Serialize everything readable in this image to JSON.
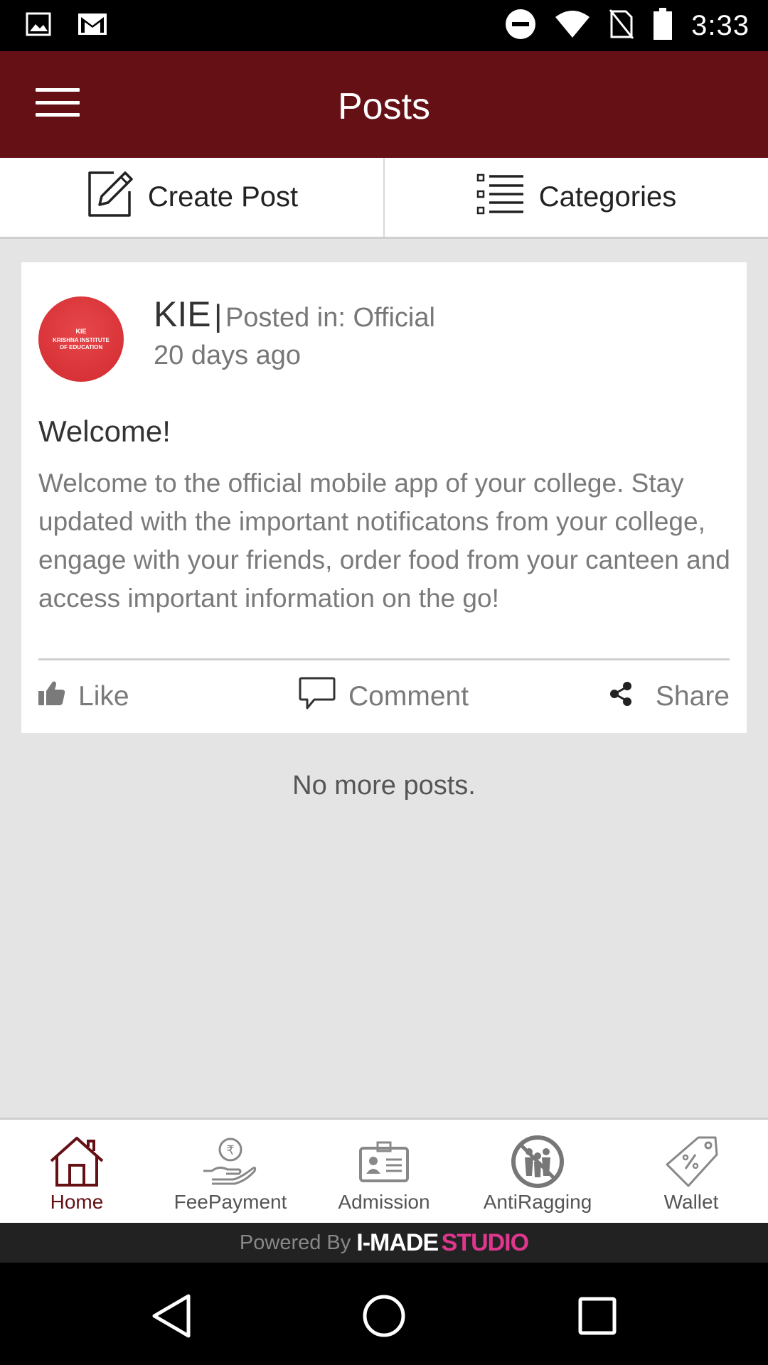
{
  "status_bar": {
    "time": "3:33",
    "icons": [
      "image-icon",
      "gmail-icon",
      "do-not-disturb-icon",
      "wifi-icon",
      "no-sim-icon",
      "battery-icon"
    ]
  },
  "app_bar": {
    "title": "Posts",
    "color": "#651015"
  },
  "actions": {
    "create_post": "Create Post",
    "categories": "Categories"
  },
  "post": {
    "avatar_text_line1": "KIE",
    "avatar_text_line2": "KRISHNA INSTITUTE OF EDUCATION",
    "author": "KIE",
    "separator": "|",
    "posted_in": "Posted in: Official",
    "time_ago": "20 days ago",
    "title": "Welcome!",
    "body": "Welcome to the official mobile app of your college. Stay updated with the important notificatons from your college, engage with your friends, order food from your canteen and access important information on the go!",
    "like": "Like",
    "comment": "Comment",
    "share": "Share"
  },
  "feed": {
    "end_message": "No more posts."
  },
  "bottom_nav": {
    "items": [
      {
        "label": "Home",
        "icon": "home-icon",
        "active": true
      },
      {
        "label": "FeePayment",
        "icon": "fee-payment-icon",
        "active": false
      },
      {
        "label": "Admission",
        "icon": "id-card-icon",
        "active": false
      },
      {
        "label": "AntiRagging",
        "icon": "anti-ragging-icon",
        "active": false
      },
      {
        "label": "Wallet",
        "icon": "tag-icon",
        "active": false
      }
    ]
  },
  "footer": {
    "powered_by": "Powered By",
    "brand_part1": "I-MADE",
    "brand_part2": "STUDIO"
  }
}
